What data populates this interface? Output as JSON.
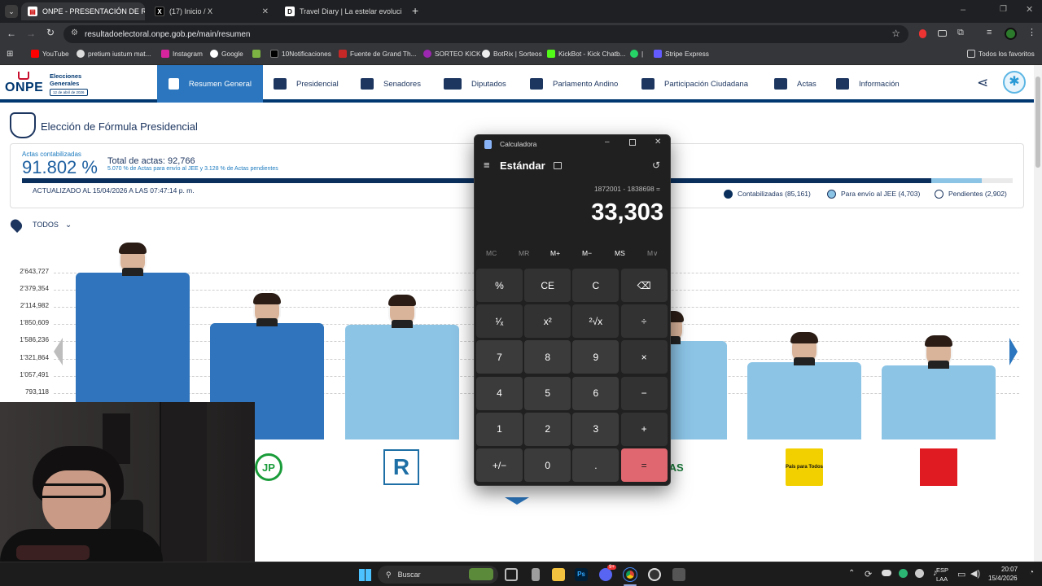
{
  "browser": {
    "tabs": [
      {
        "title": "ONPE - PRESENTACIÓN DE RES",
        "active": true,
        "favicon": "onpe-favicon"
      },
      {
        "title": "(17) Inicio / X",
        "active": false,
        "favicon": "x-favicon"
      },
      {
        "title": "Travel Diary | La estelar evoluci",
        "active": false,
        "favicon": "d-favicon"
      }
    ],
    "url": "resultadoelectoral.onpe.gob.pe/main/resumen",
    "bookmarks": [
      "YouTube",
      "pretium iustum mat...",
      "Instagram",
      "Google",
      "10Notificaciones",
      "Fuente de Grand Th...",
      "SORTEO KICK",
      "BotRix | Sorteos",
      "KickBot - Kick Chatb...",
      "|",
      "Stripe Express"
    ],
    "all_bookmarks": "Todos los favoritos"
  },
  "site": {
    "logo_text": "ONPE",
    "logo_sub1": "Elecciones",
    "logo_sub2": "Generales",
    "logo_date": "12 de abril de 2026",
    "nav": [
      "Resumen General",
      "Presidencial",
      "Senadores",
      "Diputados",
      "Parlamento Andino",
      "Participación Ciudadana",
      "Actas",
      "Información"
    ],
    "active_nav": "Resumen General"
  },
  "page": {
    "title": "Elección de Fórmula Presidencial",
    "actas_label": "Actas contabilizadas",
    "actas_pct": "91.802 %",
    "total_actas": "Total de actas: 92,766",
    "sub_note": "5.070 % de Actas para envío al JEE y 3.128 % de Actas pendientes",
    "updated": "ACTUALIZADO AL 15/04/2026 A LAS 07:47:14 p. m.",
    "progress": {
      "contabilizadas": 0.91802,
      "jee": 0.0507,
      "pendientes": 0.03128
    },
    "legend": [
      {
        "label": "Contabilizadas (85,161)",
        "color": "#0a2f5c"
      },
      {
        "label": "Para envío al JEE (4,703)",
        "color": "#8cc4e6"
      },
      {
        "label": "Pendientes (2,902)",
        "color": "#ffffff"
      }
    ],
    "filter": "TODOS"
  },
  "chart_data": {
    "type": "bar",
    "y_ticks": [
      "2'643,727",
      "2'379,354",
      "2'114,982",
      "1'850,609",
      "1'586,236",
      "1'321,864",
      "1'057,491",
      "793,118"
    ],
    "series": [
      {
        "values": [
          2643727,
          1872001,
          1838698,
          null,
          1590000,
          1270000,
          1220000
        ]
      }
    ],
    "colors": [
      "#2f74bc",
      "#2f74bc",
      "#8cc4e6",
      "#8cc4e6",
      "#8cc4e6",
      "#8cc4e6",
      "#8cc4e6"
    ],
    "party_logos": [
      "jp-logo",
      "r-logo",
      "ras-logo",
      "pais-para-todos-logo",
      "red-helmet-logo"
    ],
    "party_captions": [
      "JP",
      "R",
      "RAS",
      "País para Todos",
      ""
    ]
  },
  "calculator": {
    "title": "Calculadora",
    "mode": "Estándar",
    "expression": "1872001 - 1838698 =",
    "result": "33,303",
    "memory": [
      "MC",
      "MR",
      "M+",
      "M−",
      "MS",
      "M∨"
    ],
    "keys": [
      [
        "%",
        "CE",
        "C",
        "⌫"
      ],
      [
        "¹⁄ₓ",
        "x²",
        "²√x",
        "÷"
      ],
      [
        "7",
        "8",
        "9",
        "×"
      ],
      [
        "4",
        "5",
        "6",
        "−"
      ],
      [
        "1",
        "2",
        "3",
        "+"
      ],
      [
        "+/−",
        "0",
        ".",
        "="
      ]
    ]
  },
  "taskbar": {
    "search": "Buscar",
    "lang1": "ESP",
    "lang2": "LAA",
    "time": "20:07",
    "date": "15/4/2026",
    "badge": "9+"
  }
}
